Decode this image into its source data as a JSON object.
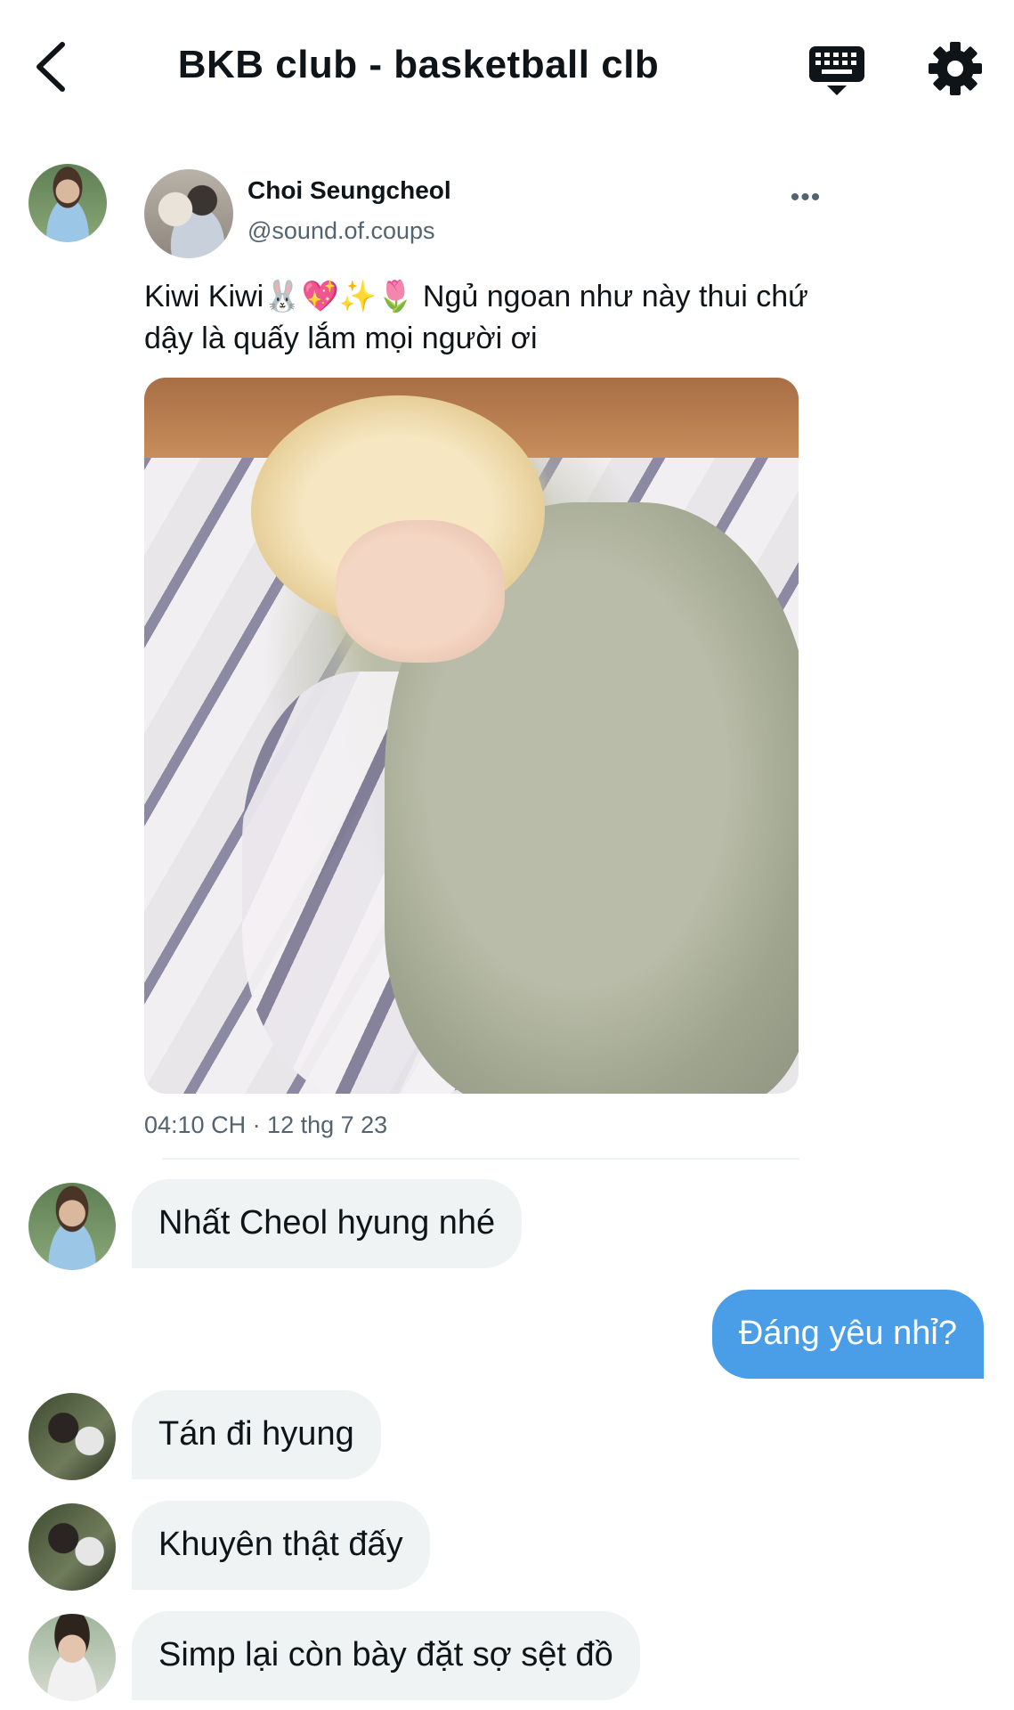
{
  "header": {
    "title": "BKB club - basketball clb",
    "back_icon": "back-chevron-icon",
    "keyboard_icon": "keyboard-icon",
    "settings_icon": "gear-icon"
  },
  "tweet": {
    "author_name": "Choi Seungcheol",
    "author_handle": "@sound.of.coups",
    "more_label": "•••",
    "text": "Kiwi Kiwi🐰💖✨🌷 Ngủ ngoan như này thui chứ dậy là quấy lắm mọi người ơi",
    "timestamp": "04:10 CH · 12 thg 7 23"
  },
  "messages": [
    {
      "direction": "in",
      "text": "Nhất Cheol hyung nhé"
    },
    {
      "direction": "out",
      "text": "Đáng yêu nhỉ?"
    },
    {
      "direction": "in",
      "text": "Tán đi hyung"
    },
    {
      "direction": "in",
      "text": "Khuyên thật đấy"
    },
    {
      "direction": "in",
      "text": "Simp lại còn bày đặt sợ sệt đồ"
    }
  ],
  "colors": {
    "accent": "#4a9ee8",
    "incoming_bubble": "#eff3f4",
    "secondary_text": "#536471"
  }
}
